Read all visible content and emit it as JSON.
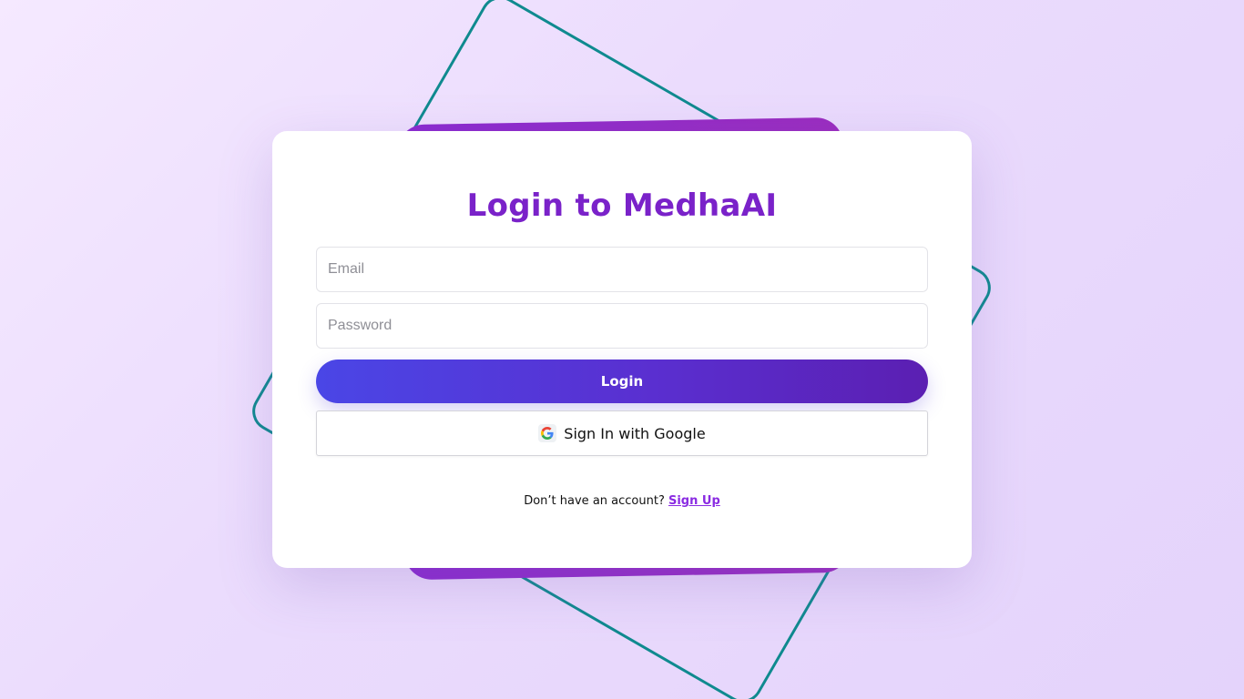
{
  "login": {
    "title": "Login to MedhaAI",
    "email_placeholder": "Email",
    "password_placeholder": "Password",
    "login_label": "Login",
    "google_label": "Sign In with Google",
    "signup_prompt": "Don’t have an account?",
    "signup_link": "Sign Up"
  },
  "icons": {
    "google": "google-g-icon"
  },
  "colors": {
    "title": "#7a22c9",
    "accent_start": "#4a46e6",
    "accent_end": "#5b1fb2",
    "decor_purple": "#8a2bd0",
    "decor_teal": "#0f8a8f",
    "link": "#8a2be2"
  }
}
